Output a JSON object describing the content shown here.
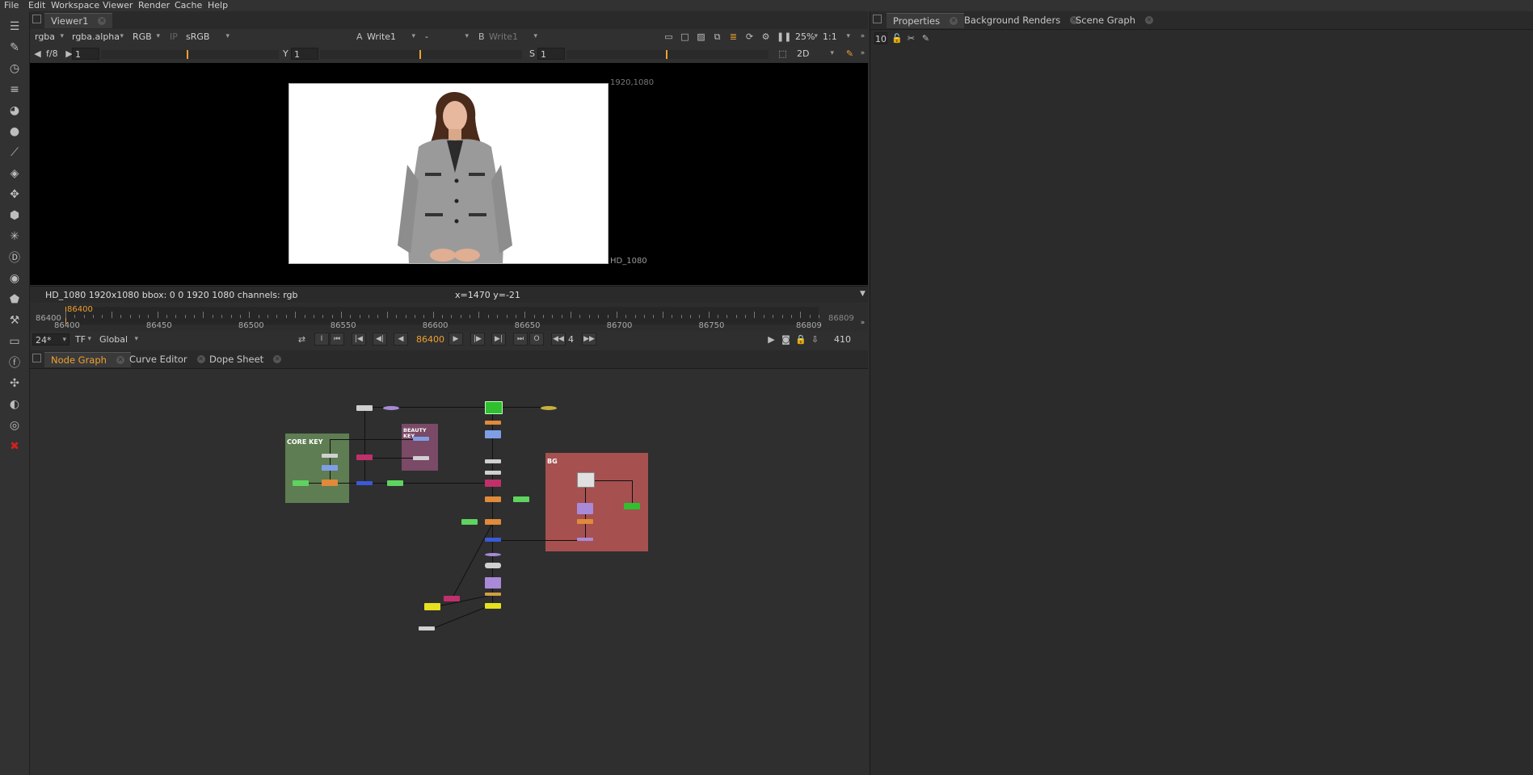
{
  "menu": [
    "File",
    "Edit",
    "Workspace",
    "Viewer",
    "Render",
    "Cache",
    "Help"
  ],
  "viewer_tab": {
    "label": "Viewer1"
  },
  "viewer_controls": {
    "channels": "rgba",
    "alpha_channel": "rgba.alpha",
    "display": "RGB",
    "ip": "IP",
    "colorspace": "sRGB",
    "input_a_label": "A",
    "input_a": "Write1",
    "blend_mode": "-",
    "input_b_label": "B",
    "input_b": "Write1",
    "zoom": "25%",
    "proxy": "1:1",
    "fstop_label": "f/8",
    "gain_value": "1",
    "gain_ticks": [
      "0.0025",
      "0.1",
      "0.2",
      "1",
      "2",
      "10",
      "20",
      "84"
    ],
    "gamma_label": "Y",
    "gamma_value": "1",
    "gamma_ticks": [
      "0",
      "0.1",
      "0.4",
      "0.7",
      "1",
      "2",
      "3",
      "4"
    ],
    "saturation_label": "S",
    "saturation_value": "1",
    "sat_ticks": [
      "0",
      "0.1",
      "0.4",
      "0.7",
      "1",
      "2",
      "3",
      "4"
    ],
    "view_mode": "2D"
  },
  "frame_labels": {
    "top_right": "1920,1080",
    "bottom_right": "HD_1080"
  },
  "info_bar": {
    "left": "HD_1080 1920x1080  bbox: 0 0 1920 1080 channels: rgb",
    "center": "x=1470 y=-21"
  },
  "timeline": {
    "start": "86400",
    "end": "86809",
    "current": "86400",
    "labels": [
      "86400",
      "86450",
      "86500",
      "86550",
      "86600",
      "86650",
      "86700",
      "86750",
      "86809"
    ]
  },
  "transport": {
    "fps": "24*",
    "tf": "TF",
    "scope": "Global",
    "current_frame": "86400",
    "increment": "4",
    "range_end": "410",
    "in_label": "I",
    "out_label": "O"
  },
  "bottom_tabs": [
    {
      "label": "Node Graph",
      "active": true
    },
    {
      "label": "Curve Editor",
      "active": false
    },
    {
      "label": "Dope Sheet",
      "active": false
    }
  ],
  "right_tabs": [
    {
      "label": "Properties",
      "active": true
    },
    {
      "label": "Background Renders",
      "active": false
    },
    {
      "label": "Scene Graph",
      "active": false
    }
  ],
  "properties": {
    "max_panels": "10"
  },
  "backdrops": [
    {
      "label": "CORE KEY",
      "color": "#5e7d52"
    },
    {
      "label": "BEAUTY KEY",
      "color": "#7a4a66"
    },
    {
      "label": "BG",
      "color": "#a65050"
    }
  ],
  "colors": {
    "accent": "#f0a030",
    "node_green": "#5fd35f",
    "node_orange": "#e08a3a",
    "node_blue": "#7f9ee6",
    "node_magenta": "#c0306a",
    "node_yellow": "#e6e020",
    "node_purple": "#a88ad8"
  }
}
